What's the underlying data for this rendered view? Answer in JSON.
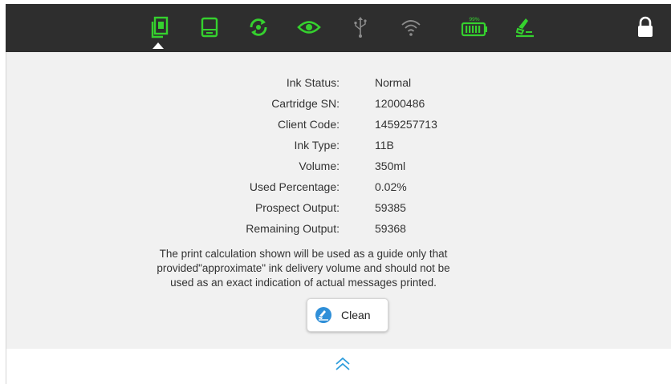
{
  "toolbar": {
    "icons": [
      "cartridge-icon",
      "printer-icon",
      "sync-icon",
      "eye-icon",
      "usb-icon",
      "wifi-icon",
      "battery-icon",
      "clean-icon",
      "lock-icon"
    ],
    "battery_label": "99%",
    "accent_color": "#35d12e",
    "muted_color": "#8c8c8c",
    "bar_color": "#2e2e2e"
  },
  "info": {
    "rows": [
      {
        "label": "Ink Status:",
        "value": "Normal"
      },
      {
        "label": "Cartridge SN:",
        "value": "12000486"
      },
      {
        "label": "Client Code:",
        "value": "1459257713"
      },
      {
        "label": "Ink Type:",
        "value": "11B"
      },
      {
        "label": "Volume:",
        "value": "350ml"
      },
      {
        "label": "Used Percentage:",
        "value": "0.02%"
      },
      {
        "label": "Prospect Output:",
        "value": "59385"
      },
      {
        "label": "Remaining Output:",
        "value": "59368"
      }
    ]
  },
  "note": {
    "line1": "The print calculation shown will be used as a guide only that",
    "line2": "provided\"approximate\" ink delivery volume and should not be",
    "line3": "used as an exact indication of actual messages printed."
  },
  "clean_button": {
    "label": "Clean"
  }
}
